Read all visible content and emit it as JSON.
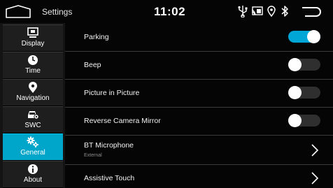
{
  "status_bar": {
    "title": "Settings",
    "time": "11:02",
    "icons": [
      "usb-icon",
      "cast-icon",
      "location-icon",
      "bluetooth-icon"
    ],
    "back_icon": "back-arrow-icon",
    "home_icon": "home-icon"
  },
  "sidebar": {
    "items": [
      {
        "label": "Display",
        "icon": "monitor-icon",
        "active": false
      },
      {
        "label": "Time",
        "icon": "clock-icon",
        "active": false
      },
      {
        "label": "Navigation",
        "icon": "location-pin-icon",
        "active": false
      },
      {
        "label": "SWC",
        "icon": "steering-wheel-control-icon",
        "active": false
      },
      {
        "label": "General",
        "icon": "gears-icon",
        "active": true
      },
      {
        "label": "About",
        "icon": "info-icon",
        "active": false
      }
    ]
  },
  "settings": [
    {
      "title": "Parking",
      "type": "toggle",
      "state": "on"
    },
    {
      "title": "Beep",
      "type": "toggle",
      "state": "off"
    },
    {
      "title": "Picture in Picture",
      "type": "toggle",
      "state": "off"
    },
    {
      "title": "Reverse Camera Mirror",
      "type": "toggle",
      "state": "off"
    },
    {
      "title": "BT Microphone",
      "subtitle": "External",
      "type": "link",
      "icon": "chevron-right-icon"
    },
    {
      "title": "Assistive Touch",
      "type": "link",
      "icon": "chevron-right-icon"
    }
  ],
  "colors": {
    "accent": "#00a6c9",
    "toggle_on": "#00a6d6",
    "background": "#050505"
  }
}
